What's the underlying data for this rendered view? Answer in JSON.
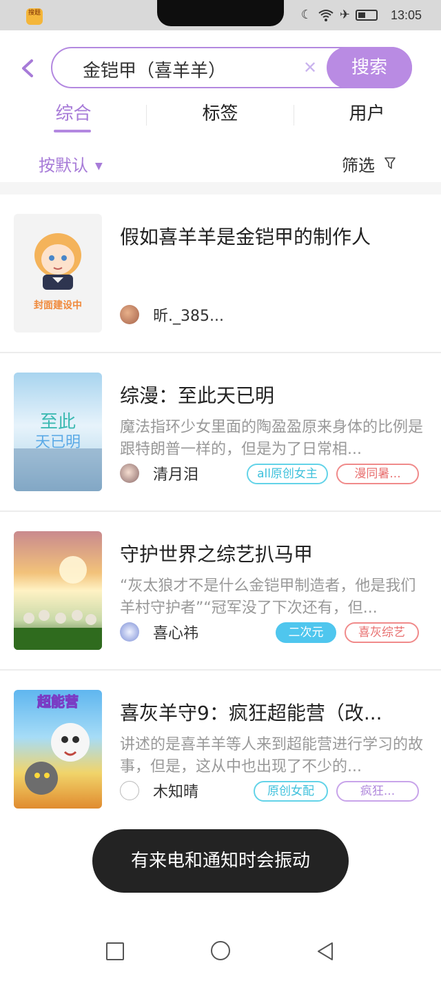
{
  "status_bar": {
    "app_icon_text": "搜题",
    "time": "13:05",
    "icons": [
      "moon-icon",
      "wifi-icon",
      "airplane-icon",
      "battery-icon"
    ]
  },
  "search": {
    "query": "金铠甲（喜羊羊）",
    "button_label": "搜索"
  },
  "tabs": [
    {
      "label": "综合",
      "active": true
    },
    {
      "label": "标签",
      "active": false
    },
    {
      "label": "用户",
      "active": false
    }
  ],
  "sort": {
    "label": "按默认"
  },
  "filter": {
    "label": "筛选"
  },
  "results": [
    {
      "title": "假如喜羊羊是金铠甲的制作人",
      "description": "",
      "cover_text": "封面建设中",
      "author": "昕._385...",
      "tags": []
    },
    {
      "title": "综漫：至此天已明",
      "description": "魔法指环少女里面的陶盈盈原来身体的比例是跟特朗普一样的，但是为了日常相...",
      "author": "清月泪",
      "tags": [
        "all原创女主",
        "漫同暑..."
      ]
    },
    {
      "title": "守护世界之综艺扒马甲",
      "description": "“灰太狼才不是什么金铠甲制造者，他是我们羊村守护者”“冠军没了下次还有，但...",
      "author": "喜心祎",
      "tags": [
        "二次元",
        "喜灰综艺"
      ]
    },
    {
      "title": "喜灰羊守9：疯狂超能营（改...",
      "description": "讲述的是喜羊羊等人来到超能营进行学习的故事，但是，这从中也出现了不少的...",
      "author": "木知晴",
      "tags": [
        "原创女配",
        "疯狂..."
      ]
    }
  ],
  "toast": {
    "text": "有来电和通知时会振动"
  },
  "colors": {
    "accent": "#b98be3",
    "accent_text": "#a77bd8"
  }
}
